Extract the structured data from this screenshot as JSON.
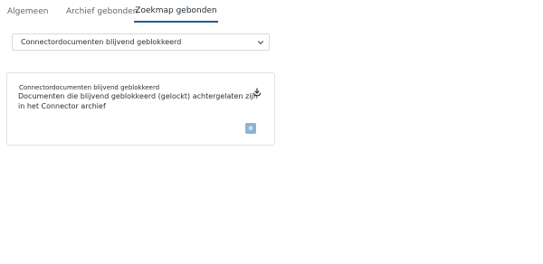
{
  "tabs": [
    {
      "label": "Algemeen",
      "active": false
    },
    {
      "label": "Archief gebonden",
      "active": false
    },
    {
      "label": "Zoekmap gebonden",
      "active": true
    }
  ],
  "select": {
    "value": "Connectordocumenten blijvend geblokkeerd",
    "icon": "chevron-down-icon"
  },
  "card": {
    "title": "Connectordocumenten blijvend geblokkeerd",
    "description": "Documenten die blijvend geblokkeerd (gelockt) achtergelaten zijn in het Connector archief",
    "action_icon": "download-icon",
    "count": "0"
  },
  "colors": {
    "active_tab_underline": "#1f5c96",
    "badge_background": "#8fb3d4",
    "border": "#dfe3e8"
  }
}
